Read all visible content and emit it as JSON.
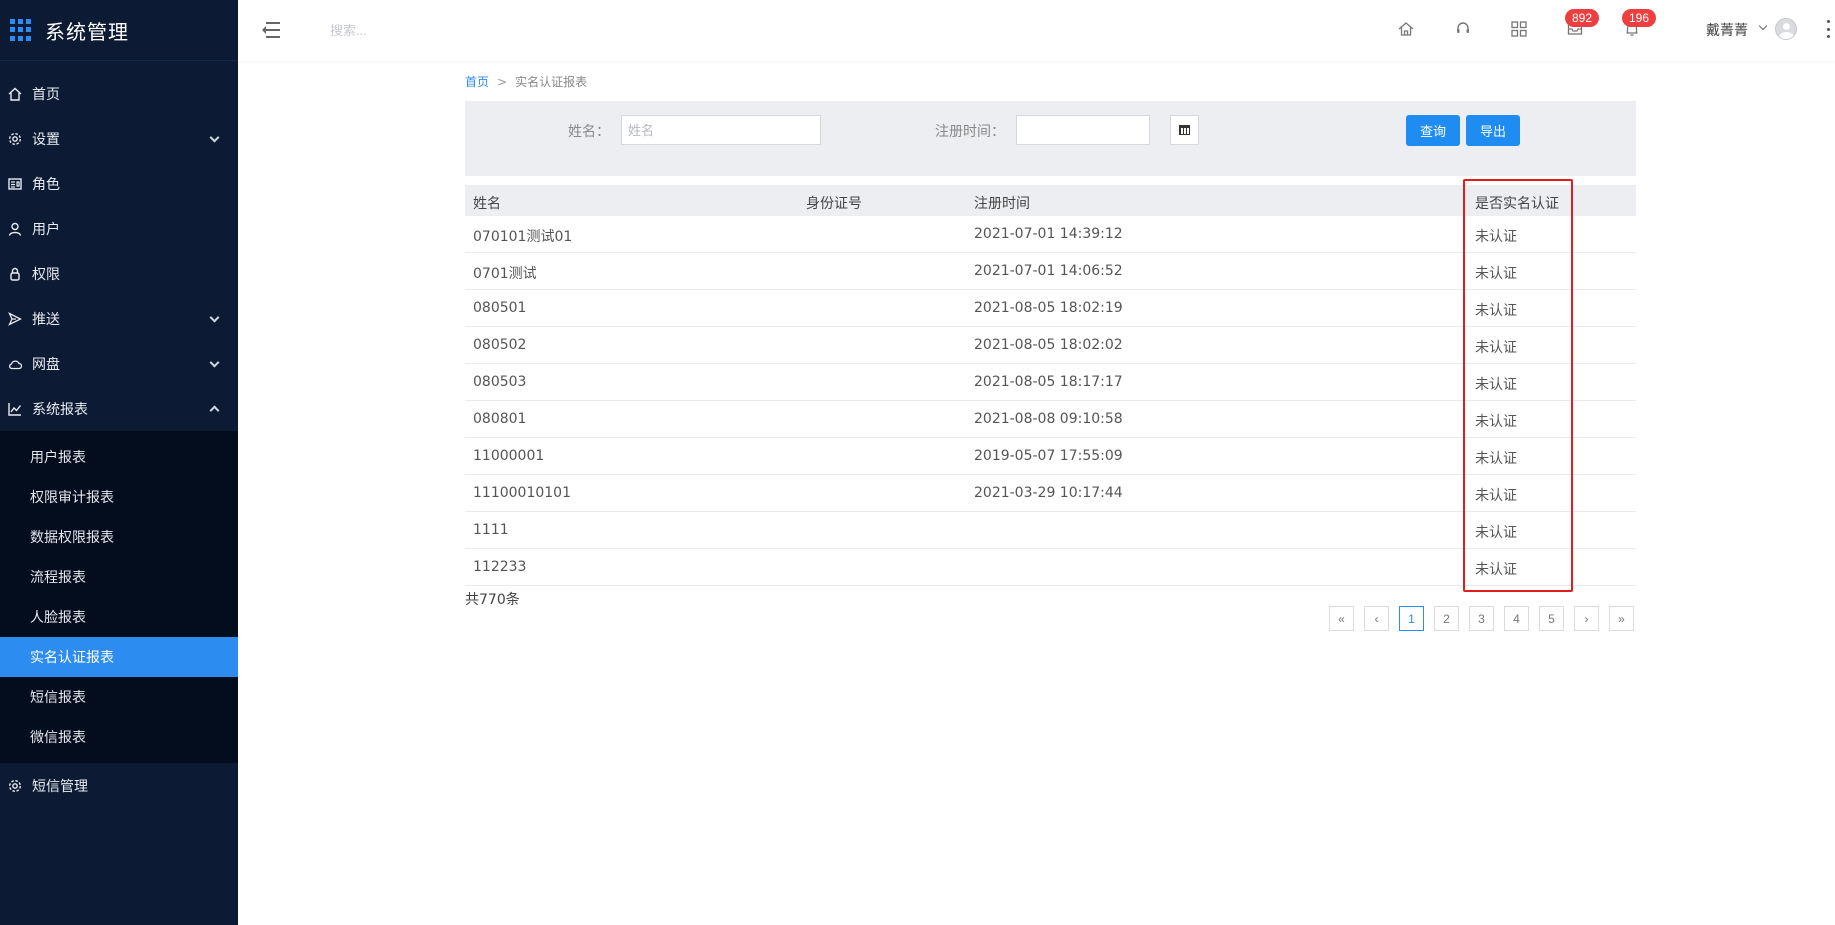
{
  "app": {
    "title": "系统管理"
  },
  "sidebar": {
    "items": [
      {
        "label": "首页",
        "icon": "home-icon"
      },
      {
        "label": "设置",
        "icon": "gear-icon"
      },
      {
        "label": "角色",
        "icon": "id-card-icon"
      },
      {
        "label": "用户",
        "icon": "user-icon"
      },
      {
        "label": "权限",
        "icon": "lock-icon"
      },
      {
        "label": "推送",
        "icon": "send-icon"
      },
      {
        "label": "网盘",
        "icon": "cloud-icon"
      },
      {
        "label": "系统报表",
        "icon": "chart-line-icon"
      },
      {
        "label": "短信管理",
        "icon": "gear-icon"
      }
    ],
    "reports_submenu": [
      "用户报表",
      "权限审计报表",
      "数据权限报表",
      "流程报表",
      "人脸报表",
      "实名认证报表",
      "短信报表",
      "微信报表"
    ],
    "active_submenu": "实名认证报表"
  },
  "header": {
    "search_placeholder": "搜索...",
    "mail_badge": "892",
    "bell_badge": "196",
    "username": "戴菁菁"
  },
  "breadcrumb": {
    "home": "首页",
    "separator": ">",
    "current": "实名认证报表"
  },
  "filter": {
    "name_label": "姓名：",
    "name_placeholder": "姓名",
    "name_value": "",
    "time_label": "注册时间：",
    "time_value": "",
    "query_button": "查询",
    "export_button": "导出"
  },
  "table": {
    "columns": [
      "姓名",
      "身份证号",
      "注册时间",
      "是否实名认证"
    ],
    "rows": [
      [
        "070101测试01",
        "",
        "2021-07-01 14:39:12",
        "未认证"
      ],
      [
        "0701测试",
        "",
        "2021-07-01 14:06:52",
        "未认证"
      ],
      [
        "080501",
        "",
        "2021-08-05 18:02:19",
        "未认证"
      ],
      [
        "080502",
        "",
        "2021-08-05 18:02:02",
        "未认证"
      ],
      [
        "080503",
        "",
        "2021-08-05 18:17:17",
        "未认证"
      ],
      [
        "080801",
        "",
        "2021-08-08 09:10:58",
        "未认证"
      ],
      [
        "11000001",
        "",
        "2019-05-07 17:55:09",
        "未认证"
      ],
      [
        "11100010101",
        "",
        "2021-03-29 10:17:44",
        "未认证"
      ],
      [
        "1111",
        "",
        "",
        "未认证"
      ],
      [
        "112233",
        "",
        "",
        "未认证"
      ]
    ],
    "highlight_color": "#e31d1d"
  },
  "footer": {
    "total": "共770条"
  },
  "pagination": {
    "first": "«",
    "prev": "‹",
    "pages": [
      "1",
      "2",
      "3",
      "4",
      "5"
    ],
    "current_page": "1",
    "next": "›",
    "last": "»"
  },
  "colors": {
    "sidebar_bg": "#0c1a33",
    "accent": "#2d8cf0",
    "badge": "#ed3f3f"
  }
}
